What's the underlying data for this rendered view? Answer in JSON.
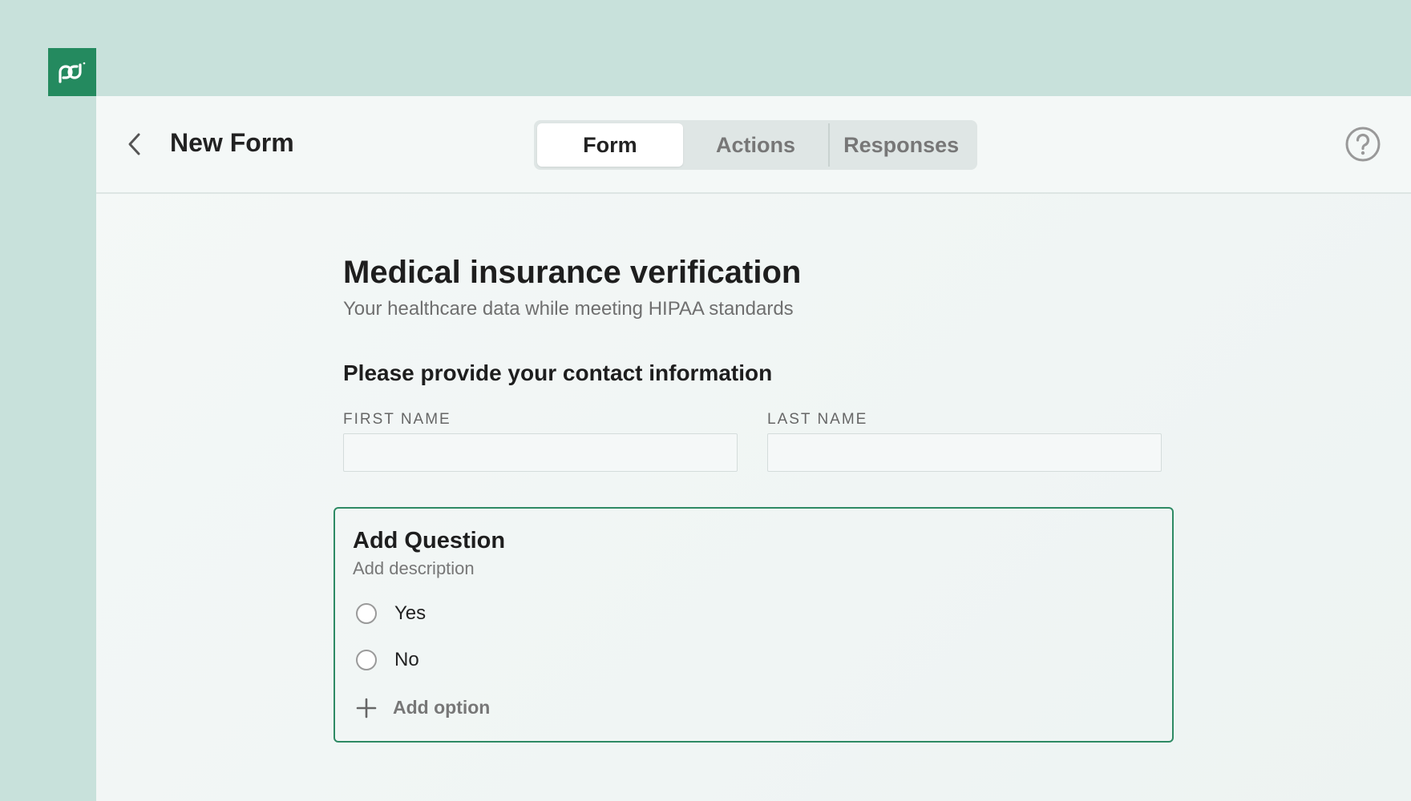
{
  "brand": {
    "logo_text": "pd",
    "color": "#248a5f"
  },
  "header": {
    "title": "New Form",
    "tabs": [
      {
        "label": "Form",
        "active": true
      },
      {
        "label": "Actions",
        "active": false
      },
      {
        "label": "Responses",
        "active": false
      }
    ],
    "help_icon": "question-circle-icon",
    "back_icon": "chevron-left-icon"
  },
  "form": {
    "title": "Medical insurance verification",
    "subtitle": "Your healthcare data while meeting HIPAA standards",
    "section_heading": "Please provide your contact information",
    "fields": [
      {
        "label": "FIRST NAME",
        "value": ""
      },
      {
        "label": "LAST NAME",
        "value": ""
      }
    ],
    "question": {
      "title": "Add Question",
      "description": "Add description",
      "options": [
        "Yes",
        "No"
      ],
      "add_option_label": "Add option",
      "border_color": "#2e8a64"
    }
  }
}
